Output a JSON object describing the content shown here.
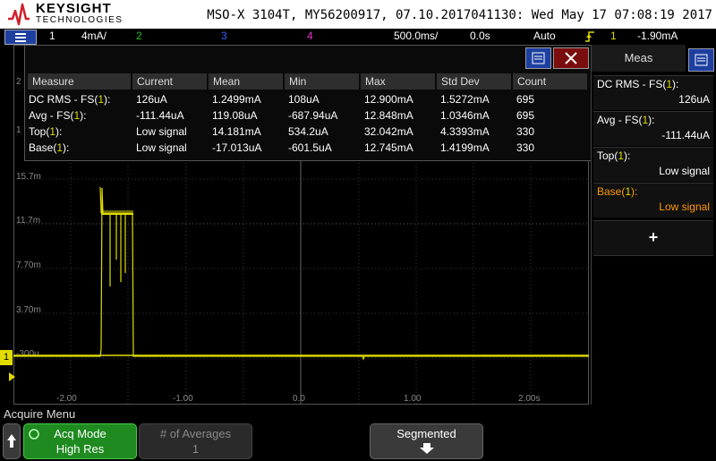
{
  "header": {
    "brand": "KEYSIGHT",
    "brand_sub": "TECHNOLOGIES",
    "scope_info": "MSO-X 3104T, MY56200917, 07.10.2017041130: Wed May 17 07:08:19 2017"
  },
  "channel_bar": {
    "ch1_num": "1",
    "ch1_scale": "4mA/",
    "ch2_num": "2",
    "ch3_num": "3",
    "ch4_num": "4",
    "timebase": "500.0ms/",
    "delay": "0.0s",
    "trigger_mode": "Auto",
    "trigger_icon": "rising-edge-icon",
    "trigger_source": "1",
    "trigger_level": "-1.90mA",
    "colors": {
      "ch1": "#e0dc00",
      "ch2": "#20c020",
      "ch3": "#3060ff",
      "ch4": "#e030d0"
    }
  },
  "measurement_table": {
    "headers": [
      "Measure",
      "Current",
      "Mean",
      "Min",
      "Max",
      "Std Dev",
      "Count"
    ],
    "rows": [
      {
        "name_pre": "DC RMS - FS(",
        "ch": "1",
        "name_post": "):",
        "current": "126uA",
        "mean": "1.2499mA",
        "min": "108uA",
        "max": "12.900mA",
        "stddev": "1.5272mA",
        "count": "695"
      },
      {
        "name_pre": "Avg - FS(",
        "ch": "1",
        "name_post": "):",
        "current": "-111.44uA",
        "mean": "119.08uA",
        "min": "-687.94uA",
        "max": "12.848mA",
        "stddev": "1.0346mA",
        "count": "695"
      },
      {
        "name_pre": "Top(",
        "ch": "1",
        "name_post": "):",
        "current": "Low signal",
        "mean": "14.181mA",
        "min": "534.2uA",
        "max": "32.042mA",
        "stddev": "4.3393mA",
        "count": "330"
      },
      {
        "name_pre": "Base(",
        "ch": "1",
        "name_post": "):",
        "current": "Low signal",
        "mean": "-17.013uA",
        "min": "-601.5uA",
        "max": "12.745mA",
        "stddev": "1.4199mA",
        "count": "330"
      }
    ]
  },
  "graticule": {
    "y_labels": [
      "15.7m",
      "11.7m",
      "7.70m",
      "3.70m",
      "-300u"
    ],
    "x_labels": [
      "-2.00",
      "-1.00",
      "0.0",
      "1.00",
      "2.00s"
    ],
    "left_ticks": [
      "2",
      "1"
    ],
    "ch1_marker": "1"
  },
  "side_panel": {
    "title": "Meas",
    "items": [
      {
        "label_pre": "DC RMS - FS(",
        "ch": "1",
        "label_post": "):",
        "value": "126uA"
      },
      {
        "label_pre": "Avg - FS(",
        "ch": "1",
        "label_post": "):",
        "value": "-111.44uA"
      },
      {
        "label_pre": "Top(",
        "ch": "1",
        "label_post": "):",
        "value": "Low signal"
      },
      {
        "label_pre": "Base(",
        "ch": "1",
        "label_post": "):",
        "value": "Low signal"
      }
    ],
    "add_label": "+",
    "highlight_color": "#ff9900"
  },
  "softkeys": {
    "menu_title": "Acquire Menu",
    "back_icon": "up-arrow-icon",
    "acq_mode_label": "Acq Mode",
    "acq_mode_value": "High Res",
    "averages_label": "# of Averages",
    "averages_value": "1",
    "segmented_label": "Segmented",
    "segmented_icon": "down-arrow-icon"
  }
}
